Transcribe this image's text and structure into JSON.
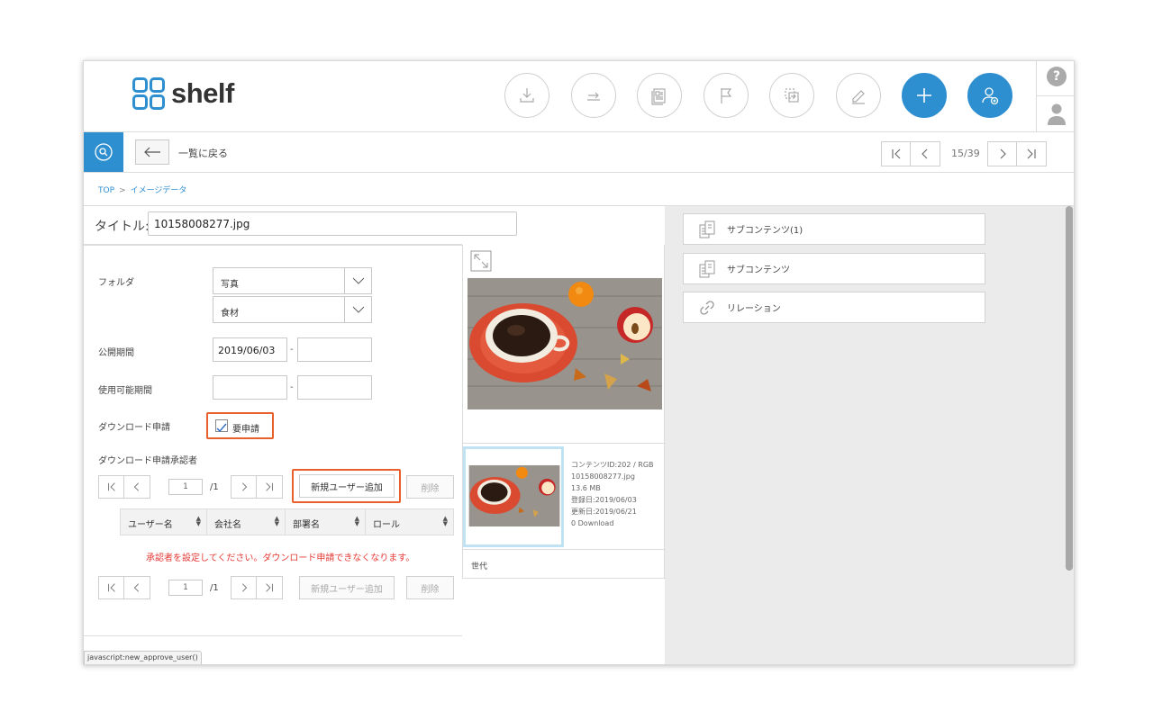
{
  "app": {
    "logo_text": "shelf"
  },
  "header": {
    "tools": [
      "download-icon",
      "export-icon",
      "catalog-icon",
      "flag-icon",
      "move-icon",
      "edit-icon",
      "plus-icon",
      "add-user-icon"
    ],
    "help_label": "?"
  },
  "toolbar": {
    "back_label": "一覧に戻る",
    "page_count": "15/39"
  },
  "breadcrumb": {
    "top": "TOP",
    "sep": ">",
    "current": "イメージデータ"
  },
  "title": {
    "label": "タイトル:",
    "value": "10158008277.jpg"
  },
  "form": {
    "folder_label": "フォルダ",
    "folder_1": "写真",
    "folder_2": "食材",
    "publish_label": "公開期間",
    "publish_start": "2019/06/03",
    "publish_end": "",
    "usable_label": "使用可能期間",
    "usable_start": "",
    "usable_end": "",
    "dash": "-",
    "download_request_label": "ダウンロード申請",
    "requires_request_label": "要申請",
    "requires_request_checked": true,
    "approvers_label": "ダウンロード申請承認者",
    "page_value": "1",
    "page_total": "/1",
    "add_user_label": "新規ユーザー追加",
    "delete_label": "削除",
    "columns": [
      "ユーザー名",
      "会社名",
      "部署名",
      "ロール"
    ],
    "warning": "承認者を設定してください。ダウンロード申請できなくなります。"
  },
  "preview": {
    "meta": [
      "コンテンツID:202 / RGB",
      "10158008277.jpg",
      "13.6 MB",
      "登録日:2019/06/03",
      "更新日:2019/06/21",
      "0 Download"
    ],
    "generation_label": "世代"
  },
  "right_panel": {
    "buttons": [
      "サブコンテンツ(1)",
      "サブコンテンツ",
      "リレーション"
    ]
  },
  "status_bar": "javascript:new_approve_user()",
  "colors": {
    "accent": "#2e8fd0",
    "highlight": "#e8602c",
    "warning": "#e53935"
  }
}
